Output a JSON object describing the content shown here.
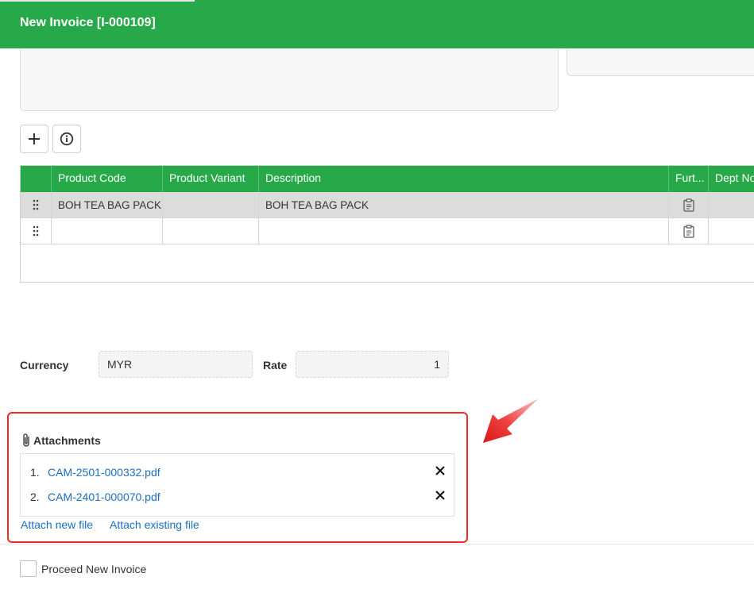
{
  "header": {
    "title": "New Invoice [I-000109]",
    "color": "#27a94a"
  },
  "toolbar": {
    "add_icon": "plus-icon",
    "info_icon": "info-icon"
  },
  "grid": {
    "columns": [
      "Product Code",
      "Product Variant",
      "Description",
      "Furt...",
      "Dept No..."
    ],
    "rows": [
      {
        "product_code": "BOH TEA BAG PACK",
        "product_variant": "",
        "description": "BOH TEA BAG PACK",
        "dept_no": ""
      },
      {
        "product_code": "",
        "product_variant": "",
        "description": "",
        "dept_no": ""
      }
    ]
  },
  "currency": {
    "label": "Currency",
    "value": "MYR",
    "rate_label": "Rate",
    "rate_value": "1"
  },
  "attachments": {
    "title": "Attachments",
    "files": [
      {
        "num": "1.",
        "name": "CAM-2501-000332.pdf"
      },
      {
        "num": "2.",
        "name": "CAM-2401-000070.pdf"
      }
    ],
    "attach_new": "Attach new file",
    "attach_existing": "Attach existing file",
    "highlight_color": "#ee2b2b"
  },
  "footer": {
    "proceed_label": "Proceed New Invoice"
  }
}
